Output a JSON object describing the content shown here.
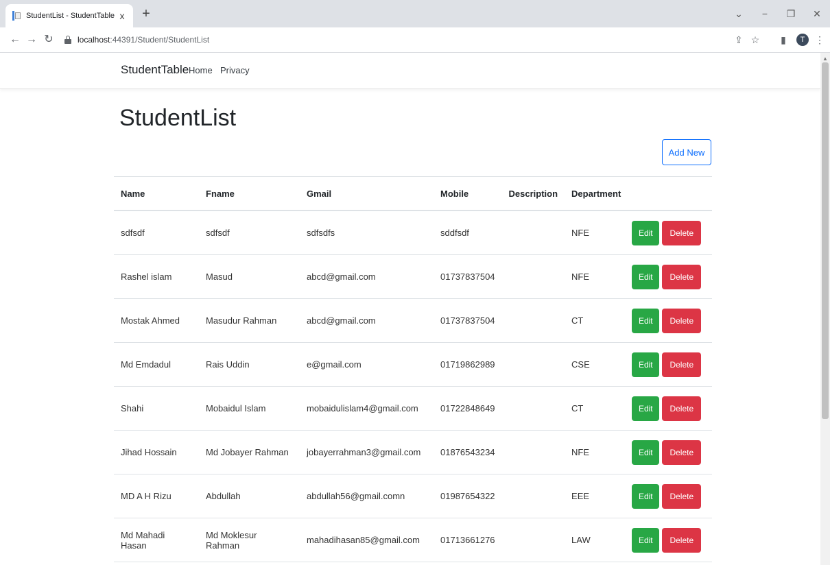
{
  "browser": {
    "tab_title": "StudentList - StudentTable",
    "tab_close": "x",
    "new_tab": "+",
    "url_host": "localhost",
    "url_path": ":44391/Student/StudentList",
    "window_controls": [
      "⌄",
      "−",
      "❐",
      "✕"
    ],
    "avatar_letter": "T"
  },
  "navbar": {
    "brand": "StudentTable",
    "links": [
      "Home",
      "Privacy"
    ]
  },
  "page": {
    "title": "StudentList",
    "add_new_label": "Add New"
  },
  "table": {
    "headers": [
      "Name",
      "Fname",
      "Gmail",
      "Mobile",
      "Description",
      "Department",
      ""
    ],
    "rows": [
      {
        "name": "sdfsdf",
        "fname": "sdfsdf",
        "gmail": "sdfsdfs",
        "mobile": "sddfsdf",
        "description": "",
        "department": "NFE"
      },
      {
        "name": "Rashel islam",
        "fname": "Masud",
        "gmail": "abcd@gmail.com",
        "mobile": "01737837504",
        "description": "",
        "department": "NFE"
      },
      {
        "name": "Mostak Ahmed",
        "fname": "Masudur Rahman",
        "gmail": "abcd@gmail.com",
        "mobile": "01737837504",
        "description": "",
        "department": "CT"
      },
      {
        "name": "Md Emdadul",
        "fname": "Rais Uddin",
        "gmail": "e@gmail.com",
        "mobile": "01719862989",
        "description": "",
        "department": "CSE"
      },
      {
        "name": "Shahi",
        "fname": "Mobaidul Islam",
        "gmail": "mobaidulislam4@gmail.com",
        "mobile": "01722848649",
        "description": "",
        "department": "CT"
      },
      {
        "name": "Jihad Hossain",
        "fname": "Md Jobayer Rahman",
        "gmail": "jobayerrahman3@gmail.com",
        "mobile": "01876543234",
        "description": "",
        "department": "NFE"
      },
      {
        "name": "MD A H Rizu",
        "fname": "Abdullah",
        "gmail": "abdullah56@gmail.comn",
        "mobile": "01987654322",
        "description": "",
        "department": "EEE"
      },
      {
        "name": "Md Mahadi Hasan",
        "fname": "Md Moklesur Rahman",
        "gmail": "mahadihasan85@gmail.com",
        "mobile": "01713661276",
        "description": "",
        "department": "LAW"
      }
    ],
    "edit_label": "Edit",
    "delete_label": "Delete"
  },
  "colors": {
    "edit": "#28a745",
    "delete": "#dc3545",
    "primary": "#0d6efd"
  }
}
